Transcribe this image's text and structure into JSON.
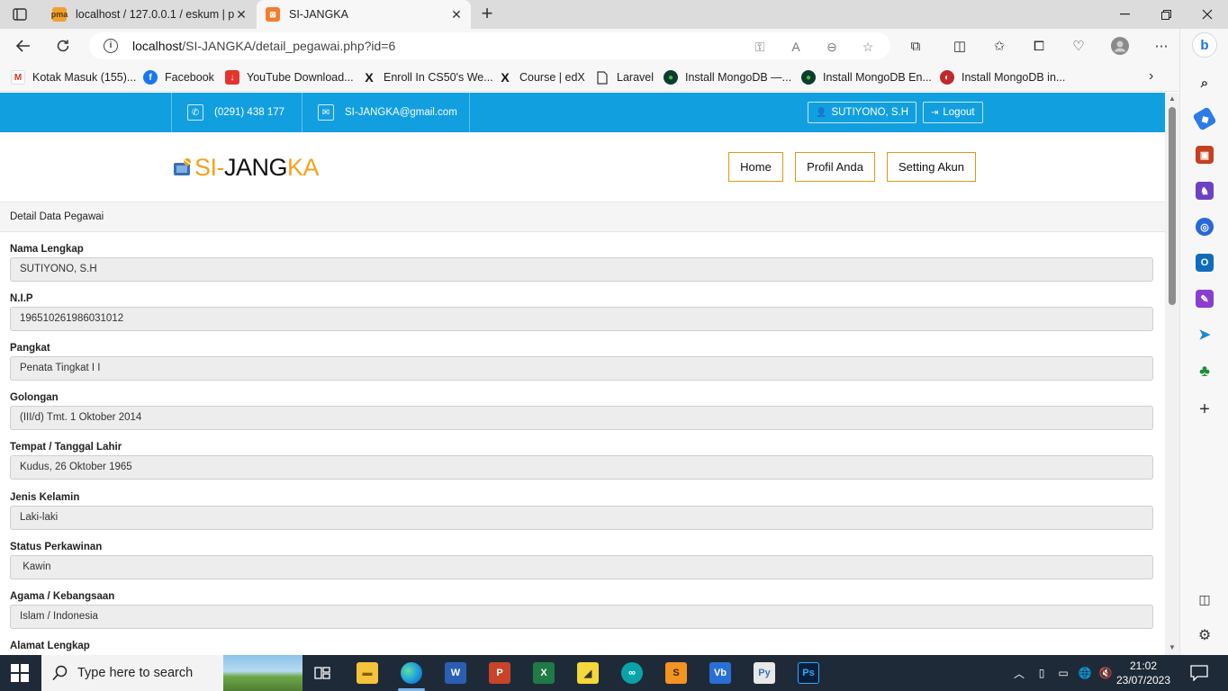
{
  "browser": {
    "tabs": [
      {
        "title": "localhost / 127.0.0.1 / eskum | phpMyAdmin",
        "favicon": "phpmyadmin-icon",
        "active": false
      },
      {
        "title": "SI-JANGKA",
        "favicon": "xampp-icon",
        "active": true
      }
    ],
    "url": {
      "host": "localhost",
      "path": "/SI-JANGKA/detail_pegawai.php?id=6"
    },
    "bookmarks": [
      {
        "label": "Kotak Masuk (155)...",
        "icon": "gmail-icon"
      },
      {
        "label": "Facebook",
        "icon": "facebook-icon"
      },
      {
        "label": "YouTube Download...",
        "icon": "download-icon"
      },
      {
        "label": "Enroll In CS50's We...",
        "icon": "edx-icon"
      },
      {
        "label": "Course | edX",
        "icon": "edx-icon"
      },
      {
        "label": "Laravel",
        "icon": "page-icon"
      },
      {
        "label": "Install MongoDB —...",
        "icon": "mongodb-icon"
      },
      {
        "label": "Install MongoDB En...",
        "icon": "mongodb-icon"
      },
      {
        "label": "Install MongoDB in...",
        "icon": "generic-site-icon"
      }
    ]
  },
  "site": {
    "phone": "(0291) 438 177",
    "email": "SI-JANGKA@gmail.com",
    "user": "SUTIYONO, S.H",
    "logout_label": "Logout",
    "logo": {
      "part1": "SI-",
      "part2": "JANG",
      "part3": "KA"
    },
    "menu": [
      "Home",
      "Profil Anda",
      "Setting Akun"
    ],
    "accent_color": "#129fe0",
    "brand_color": "#f3a21b"
  },
  "detail": {
    "heading": "Detail Data Pegawai",
    "fields": [
      {
        "label": "Nama Lengkap",
        "value": "SUTIYONO, S.H"
      },
      {
        "label": "N.I.P",
        "value": "196510261986031012"
      },
      {
        "label": "Pangkat",
        "value": "Penata Tingkat I I"
      },
      {
        "label": "Golongan",
        "value": "(III/d) Tmt. 1 Oktober 2014"
      },
      {
        "label": "Tempat / Tanggal Lahir",
        "value": "Kudus, 26 Oktober 1965"
      },
      {
        "label": "Jenis Kelamin",
        "value": "Laki-laki"
      },
      {
        "label": "Status Perkawinan",
        "value": " Kawin"
      },
      {
        "label": "Agama / Kebangsaan",
        "value": "Islam / Indonesia"
      },
      {
        "label": "Alamat Lengkap",
        "value": ""
      }
    ]
  },
  "taskbar": {
    "search_placeholder": "Type here to search",
    "time": "21:02",
    "date": "23/07/2023"
  }
}
